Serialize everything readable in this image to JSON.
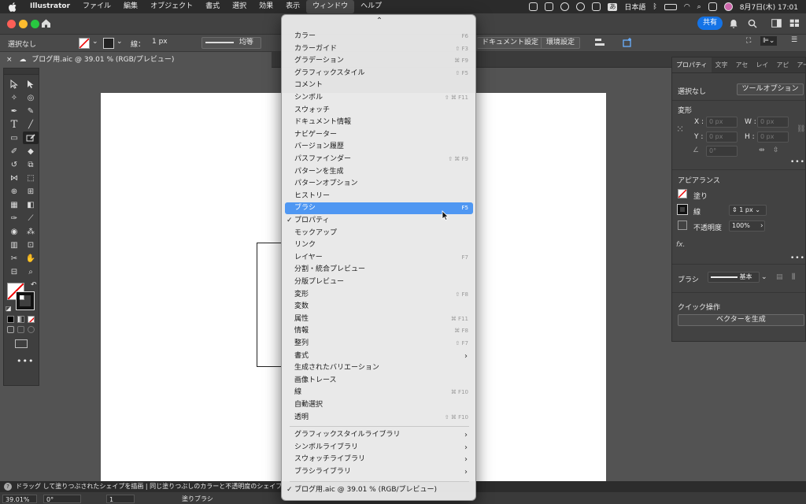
{
  "menubar": {
    "app_name": "Illustrator",
    "items": [
      "ファイル",
      "編集",
      "オブジェクト",
      "書式",
      "選択",
      "効果",
      "表示",
      "ウィンドウ",
      "ヘルプ"
    ],
    "active_item": "ウィンドウ",
    "input_mode_badge": "あ",
    "input_language": "日本語",
    "clock": "8月7日(木)  17:01"
  },
  "appbar": {
    "share_label": "共有"
  },
  "control_bar": {
    "selection_label": "選択なし",
    "stroke_label": "線：",
    "stroke_weight": "1 px",
    "stroke_profile": "均等",
    "document_setup": "ドキュメント設定",
    "preferences": "環境設定"
  },
  "doc_tab": {
    "title": "ブログ用.aic @ 39.01 % (RGB/プレビュー)"
  },
  "properties_panel": {
    "tabs": [
      "プロパティ",
      "文字",
      "アセ",
      "レイ",
      "アピ",
      "アー"
    ],
    "selection": "選択なし",
    "tool_options_button": "ツールオプション",
    "transform_title": "変形",
    "x_label": "X :",
    "x_placeholder": "0 px",
    "y_label": "Y :",
    "y_placeholder": "0 px",
    "w_label": "W :",
    "w_placeholder": "0 px",
    "h_label": "H :",
    "h_placeholder": "0 px",
    "angle_placeholder": "0°",
    "appearance_title": "アピアランス",
    "fill_label": "塗り",
    "stroke_label": "線",
    "stroke_weight": "1 px",
    "opacity_label": "不透明度",
    "opacity_value": "100%",
    "fx_label": "fx.",
    "brush_label": "ブラシ",
    "brush_value": "基本",
    "quick_actions_title": "クイック操作",
    "vectorize_button": "ベクターを生成"
  },
  "status_bar": {
    "message": "ドラッグ して塗りつぶされたシェイプを描画  |  同じ塗りつぶしのカラーと不透明度のシェイプ",
    "zoom": "39.01%",
    "rotation": "0°",
    "artboard_num": "1",
    "current_tool": "塗りブラシ"
  },
  "window_menu": {
    "items": [
      {
        "label": "カラー",
        "shortcut": "F6"
      },
      {
        "label": "カラーガイド",
        "shortcut": "⇧ F3"
      },
      {
        "label": "グラデーション",
        "shortcut": "⌘ F9"
      },
      {
        "label": "グラフィックスタイル",
        "shortcut": "⇧ F5"
      },
      {
        "label": "コメント",
        "shortcut": ""
      },
      {
        "label": "シンボル",
        "shortcut": "⇧ ⌘ F11"
      },
      {
        "label": "スウォッチ",
        "shortcut": ""
      },
      {
        "label": "ドキュメント情報",
        "shortcut": ""
      },
      {
        "label": "ナビゲーター",
        "shortcut": ""
      },
      {
        "label": "バージョン履歴",
        "shortcut": ""
      },
      {
        "label": "パスファインダー",
        "shortcut": "⇧ ⌘ F9"
      },
      {
        "label": "パターンを生成",
        "shortcut": ""
      },
      {
        "label": "パターンオプション",
        "shortcut": ""
      },
      {
        "label": "ヒストリー",
        "shortcut": ""
      },
      {
        "label": "ブラシ",
        "shortcut": "F5",
        "highlighted": true
      },
      {
        "label": "プロパティ",
        "shortcut": "",
        "checked": true
      },
      {
        "label": "モックアップ",
        "shortcut": ""
      },
      {
        "label": "リンク",
        "shortcut": ""
      },
      {
        "label": "レイヤー",
        "shortcut": "F7"
      },
      {
        "label": "分割・統合プレビュー",
        "shortcut": ""
      },
      {
        "label": "分版プレビュー",
        "shortcut": ""
      },
      {
        "label": "変形",
        "shortcut": "⇧ F8"
      },
      {
        "label": "変数",
        "shortcut": ""
      },
      {
        "label": "属性",
        "shortcut": "⌘ F11"
      },
      {
        "label": "情報",
        "shortcut": "⌘ F8"
      },
      {
        "label": "整列",
        "shortcut": "⇧ F7"
      },
      {
        "label": "書式",
        "shortcut": "",
        "submenu": true
      },
      {
        "label": "生成されたバリエーション",
        "shortcut": ""
      },
      {
        "label": "画像トレース",
        "shortcut": ""
      },
      {
        "label": "線",
        "shortcut": "⌘ F10"
      },
      {
        "label": "自動選択",
        "shortcut": ""
      },
      {
        "label": "透明",
        "shortcut": "⇧ ⌘ F10"
      }
    ],
    "library_items": [
      {
        "label": "グラフィックスタイルライブラリ",
        "submenu": true
      },
      {
        "label": "シンボルライブラリ",
        "submenu": true
      },
      {
        "label": "スウォッチライブラリ",
        "submenu": true
      },
      {
        "label": "ブラシライブラリ",
        "submenu": true
      }
    ],
    "open_document": "ブログ用.aic @ 39.01 % (RGB/プレビュー)"
  },
  "colors": {
    "accent": "#1473e6",
    "menu_highlight": "#4f97f2"
  }
}
